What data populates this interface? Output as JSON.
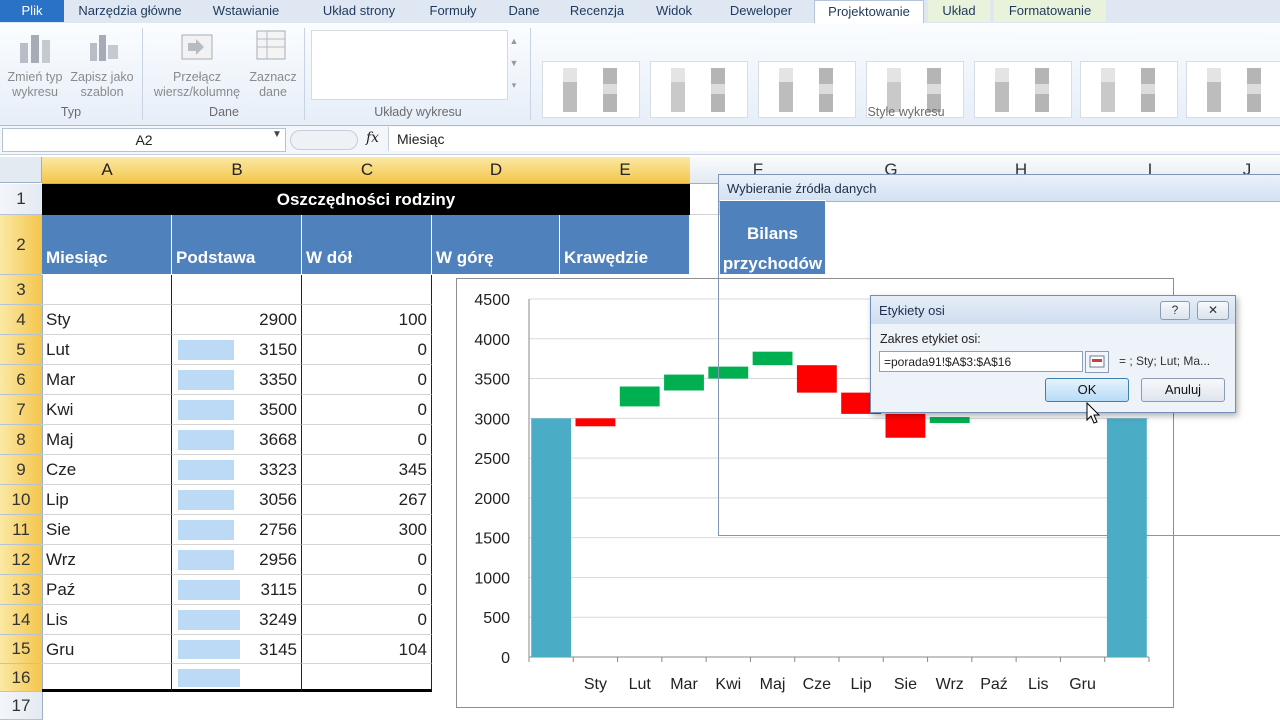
{
  "ribbon": {
    "tabs": [
      "Plik",
      "Narzędzia główne",
      "Wstawianie",
      "Układ strony",
      "Formuły",
      "Dane",
      "Recenzja",
      "Widok",
      "Deweloper",
      "Projektowanie",
      "Układ",
      "Formatowanie"
    ],
    "buttons": {
      "change_type": "Zmień typ wykresu",
      "save_template": "Zapisz jako szablon",
      "switch": "Przełącz wiersz/kolumnę",
      "select_data": "Zaznacz dane"
    },
    "groups": {
      "type": "Typ",
      "data": "Dane",
      "layouts": "Układy wykresu",
      "styles": "Style wykresu"
    }
  },
  "formula_bar": {
    "name_box": "A2",
    "fx": "fx",
    "value": "Miesiąc"
  },
  "sheet": {
    "columns": [
      "A",
      "B",
      "C",
      "D",
      "E",
      "F",
      "G",
      "H",
      "I",
      "J"
    ],
    "rows": [
      "1",
      "2",
      "3",
      "4",
      "5",
      "6",
      "7",
      "8",
      "9",
      "10",
      "11",
      "12",
      "13",
      "14",
      "15",
      "16",
      "17"
    ],
    "title": "Oszczędności rodziny",
    "headers": [
      "Miesiąc",
      "Podstawa",
      "W dół",
      "W górę",
      "Krawędzie",
      "Bilans",
      "przychodów"
    ],
    "data": [
      [
        "Sty",
        "2900",
        "100"
      ],
      [
        "Lut",
        "3150",
        "0"
      ],
      [
        "Mar",
        "3350",
        "0"
      ],
      [
        "Kwi",
        "3500",
        "0"
      ],
      [
        "Maj",
        "3668",
        "0"
      ],
      [
        "Cze",
        "3323",
        "345"
      ],
      [
        "Lip",
        "3056",
        "267"
      ],
      [
        "Sie",
        "2756",
        "300"
      ],
      [
        "Wrz",
        "2956",
        "0"
      ],
      [
        "Paź",
        "3115",
        "0"
      ],
      [
        "Lis",
        "3249",
        "0"
      ],
      [
        "Gru",
        "3145",
        "104"
      ]
    ]
  },
  "chart_data": {
    "type": "bar",
    "categories": [
      "",
      "Sty",
      "Lut",
      "Mar",
      "Kwi",
      "Maj",
      "Cze",
      "Lip",
      "Sie",
      "Wrz",
      "Paź",
      "Lis",
      "Gru",
      ""
    ],
    "yticks": [
      "0",
      "500",
      "1000",
      "1500",
      "2000",
      "2500",
      "3000",
      "3500",
      "4000",
      "4500"
    ],
    "ylim": [
      0,
      4500
    ],
    "edges": [
      {
        "index": 0,
        "value": 3000
      },
      {
        "index": 13,
        "value": 3000
      }
    ],
    "down": [
      {
        "index": 1,
        "base": 2900,
        "height": 100
      },
      {
        "index": 6,
        "base": 3323,
        "height": 345
      },
      {
        "index": 7,
        "base": 3056,
        "height": 267
      },
      {
        "index": 8,
        "base": 2756,
        "height": 300
      }
    ],
    "up": [
      {
        "index": 2,
        "base": 3150,
        "height": 250
      },
      {
        "index": 3,
        "base": 3350,
        "height": 200
      },
      {
        "index": 4,
        "base": 3500,
        "height": 150
      },
      {
        "index": 5,
        "base": 3668,
        "height": 170
      },
      {
        "index": 9,
        "base": 2956,
        "height": 60
      }
    ],
    "colors": {
      "edge": "#4bacc6",
      "up": "#00b050",
      "down": "#ff0000",
      "grid": "#d9d9d9"
    }
  },
  "dialog_source": {
    "title": "Wybieranie źródła danych"
  },
  "dialog_axis": {
    "title": "Etykiety osi",
    "help": "?",
    "range_label": "Zakres etykiet osi:",
    "range_value": "=porada91!$A$3:$A$16",
    "preview": "= ; Sty; Lut; Ma...",
    "ok": "OK",
    "cancel": "Anuluj"
  }
}
